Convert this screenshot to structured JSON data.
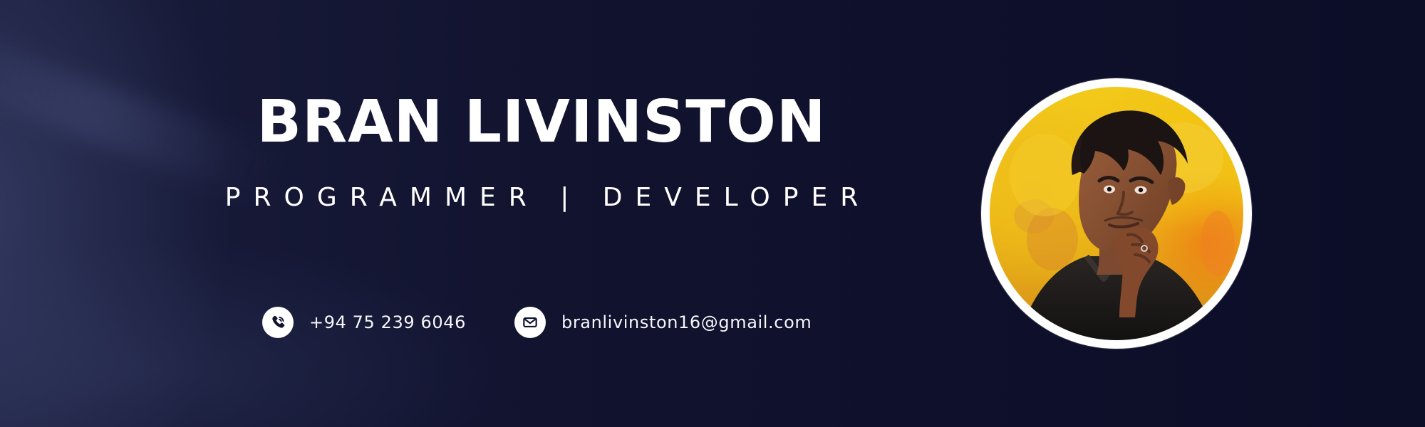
{
  "profile": {
    "name": "BRAN LIVINSTON",
    "roles": "PROGRAMMER | DEVELOPER"
  },
  "contacts": {
    "phone": {
      "icon": "phone-icon",
      "value": "+94 75 239 6046"
    },
    "email": {
      "icon": "mail-icon",
      "value": "branlivinston16@gmail.com"
    }
  },
  "colors": {
    "background_dark": "#0c0e28",
    "background_soft": "#1a1d3c",
    "text": "#ffffff",
    "photo_yellow": "#f2c91b"
  }
}
